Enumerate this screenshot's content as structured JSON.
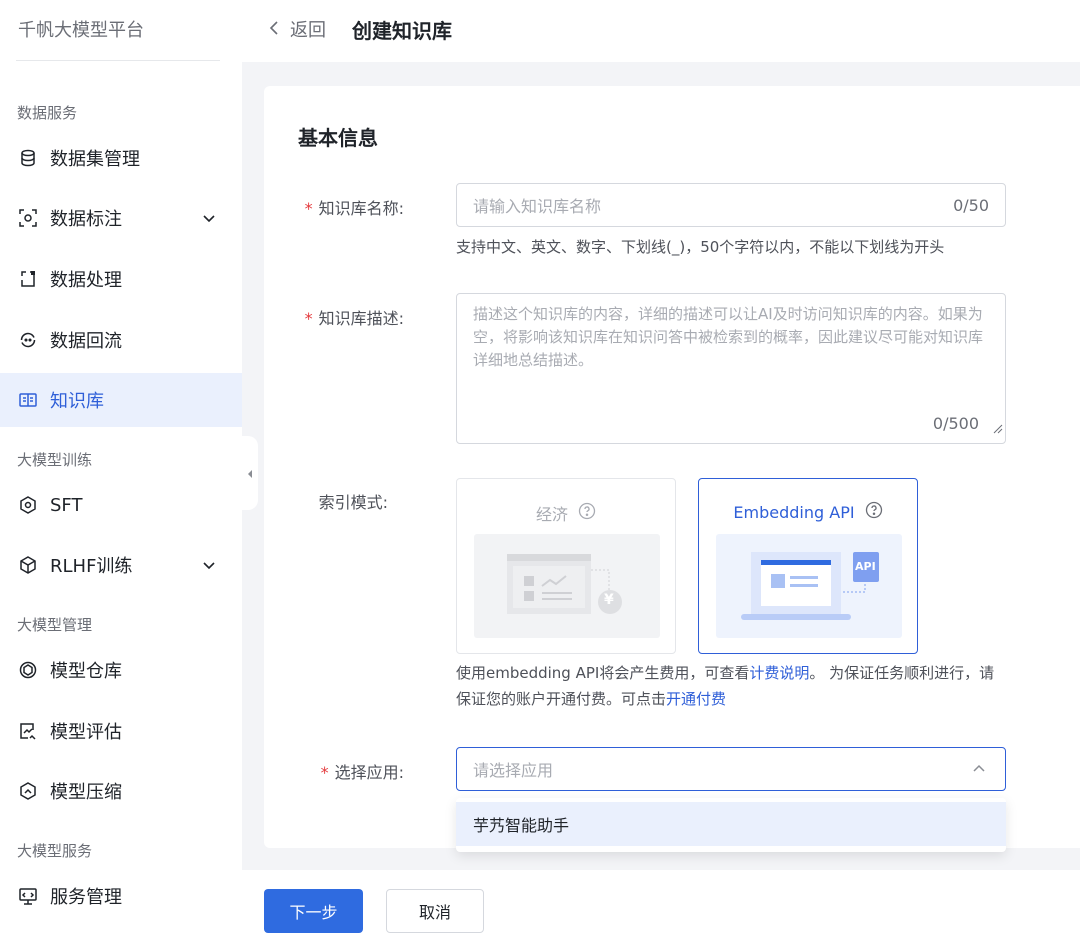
{
  "sidebar": {
    "brand": "千帆大模型平台",
    "sections": [
      {
        "label": "数据服务"
      },
      {
        "label": "大模型训练"
      },
      {
        "label": "大模型管理"
      },
      {
        "label": "大模型服务"
      }
    ],
    "items": [
      {
        "label": "数据集管理",
        "icon": "database-icon"
      },
      {
        "label": "数据标注",
        "icon": "annotate-icon"
      },
      {
        "label": "数据处理",
        "icon": "process-icon"
      },
      {
        "label": "数据回流",
        "icon": "reflow-icon"
      },
      {
        "label": "知识库",
        "icon": "book-icon"
      },
      {
        "label": "SFT",
        "icon": "sft-icon"
      },
      {
        "label": "RLHF训练",
        "icon": "cube-icon"
      },
      {
        "label": "模型仓库",
        "icon": "model-repo-icon"
      },
      {
        "label": "模型评估",
        "icon": "eval-icon"
      },
      {
        "label": "模型压缩",
        "icon": "compress-icon"
      },
      {
        "label": "服务管理",
        "icon": "service-icon"
      }
    ]
  },
  "header": {
    "back_label": "返回",
    "title": "创建知识库"
  },
  "form": {
    "section_title": "基本信息",
    "name_label": "知识库名称:",
    "name_placeholder": "请输入知识库名称",
    "name_counter": "0/50",
    "name_hint": "支持中文、英文、数字、下划线(_)，50个字符以内，不能以下划线为开头",
    "desc_label": "知识库描述:",
    "desc_placeholder": "描述这个知识库的内容，详细的描述可以让AI及时访问知识库的内容。如果为空，将影响该知识库在知识问答中被检索到的概率，因此建议尽可能对知识库详细地总结描述。",
    "desc_counter": "0/500",
    "index_label": "索引模式:",
    "mode_economy": "经济",
    "mode_embedding": "Embedding API",
    "api_badge": "API",
    "yen_badge": "¥",
    "embedding_hint_1": "使用embedding API将会产生费用，可查看",
    "embedding_hint_link": "计费说明",
    "embedding_hint_2": "。 为保证任务顺利进行，请保证您的账户开通付费。可点击",
    "embedding_hint_link2": "开通付费",
    "app_label": "选择应用:",
    "app_placeholder": "请选择应用",
    "app_options": [
      "芋艿智能助手"
    ]
  },
  "footer": {
    "next_label": "下一步",
    "cancel_label": "取消"
  },
  "colors": {
    "accent": "#2f5fd8",
    "primary_button": "#2f6be0",
    "required": "#e4393c",
    "active_nav_bg": "#eaf0fd"
  }
}
